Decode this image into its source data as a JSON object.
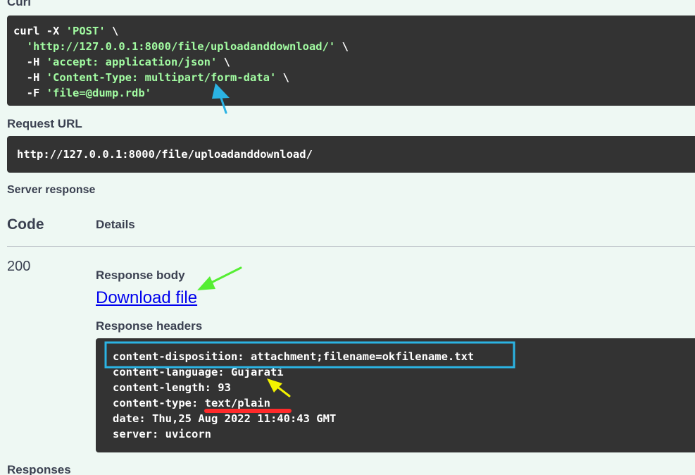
{
  "curl": {
    "label": "Curl",
    "lines": [
      {
        "prefix": "curl -X ",
        "str": "'POST'",
        "suffix": " \\"
      },
      {
        "prefix": "  ",
        "str": "'http://127.0.0.1:8000/file/uploadanddownload/'",
        "suffix": " \\"
      },
      {
        "prefix": "  -H ",
        "str": "'accept: application/json'",
        "suffix": " \\"
      },
      {
        "prefix": "  -H ",
        "str": "'Content-Type: multipart/form-data'",
        "suffix": " \\"
      },
      {
        "prefix": "  -F ",
        "str": "'file=@dump.rdb'",
        "suffix": ""
      }
    ]
  },
  "request_url": {
    "label": "Request URL",
    "value": "http://127.0.0.1:8000/file/uploadanddownload/"
  },
  "server_response": {
    "label": "Server response",
    "code_header": "Code",
    "details_header": "Details",
    "code": "200",
    "response_body_label": "Response body",
    "download_link": "Download file",
    "response_headers_label": "Response headers",
    "headers": [
      "content-disposition: attachment;filename=okfilename.txt",
      "content-language: Gujarati",
      "content-length: 93",
      "content-type: text/plain",
      "date: Thu,25 Aug 2022 11:40:43 GMT",
      "server: uvicorn"
    ]
  },
  "responses_label": "Responses",
  "colors": {
    "page_bg": "#eef8f3",
    "code_bg": "#333333",
    "string_green": "#a2fca2",
    "link_blue": "#0000ee",
    "highlight_box": "#2bb3e3",
    "arrow_cyan": "#2bb3e3",
    "arrow_green": "#55ee33",
    "arrow_yellow": "#f2f200",
    "underline_red": "#ff2a2a"
  }
}
